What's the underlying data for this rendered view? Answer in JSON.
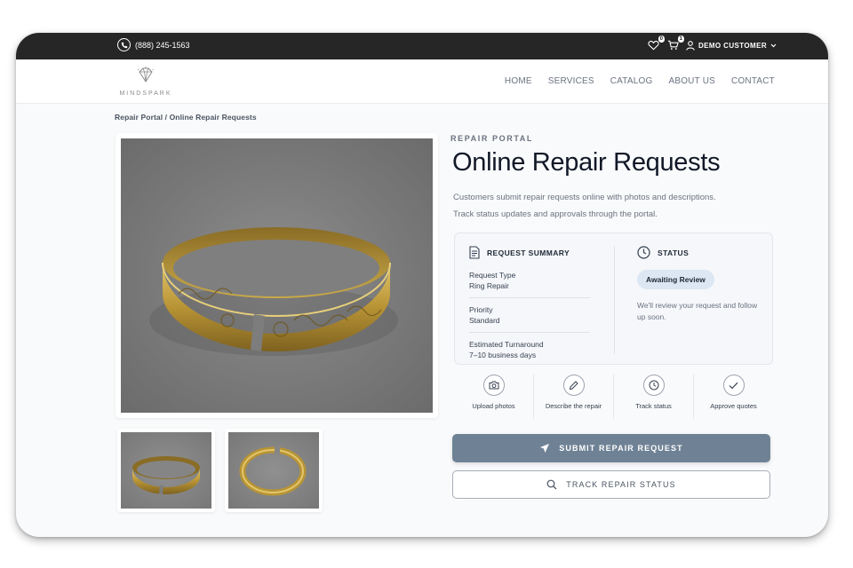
{
  "topbar": {
    "phone": "(888) 245-1563",
    "wishlist_count": "0",
    "cart_count": "1",
    "account_label": "DEMO CUSTOMER"
  },
  "brand": {
    "name": "MINDSPARK"
  },
  "nav": {
    "items": [
      "HOME",
      "SERVICES",
      "CATALOG",
      "ABOUT US",
      "CONTACT"
    ]
  },
  "breadcrumb": "Repair Portal / Online Repair Requests",
  "hero": {
    "eyebrow": "REPAIR PORTAL",
    "title": "Online Repair Requests",
    "description_line1": "Customers submit repair requests online with photos and descriptions.",
    "description_line2": "Track status updates and approvals through the portal."
  },
  "summary": {
    "heading": "REQUEST SUMMARY",
    "fields": [
      {
        "label": "Request Type",
        "value": "Ring Repair"
      },
      {
        "label": "Priority",
        "value": "Standard"
      },
      {
        "label": "Estimated Turnaround",
        "value": "7–10 business days"
      }
    ]
  },
  "status": {
    "heading": "STATUS",
    "pill": "Awaiting Review",
    "note": "We'll review your request and follow up soon."
  },
  "steps": [
    {
      "label": "Upload photos",
      "icon": "camera-icon"
    },
    {
      "label": "Describe the repair",
      "icon": "pencil-icon"
    },
    {
      "label": "Track status",
      "icon": "clock-icon"
    },
    {
      "label": "Approve quotes",
      "icon": "check-icon"
    }
  ],
  "actions": {
    "submit_label": "SUBMIT REPAIR REQUEST",
    "track_label": "TRACK REPAIR STATUS"
  },
  "colors": {
    "topbar": "#262626",
    "primary_button": "#6f8295",
    "status_pill": "#dde7f3",
    "ring_gold": "#c9a94a"
  }
}
